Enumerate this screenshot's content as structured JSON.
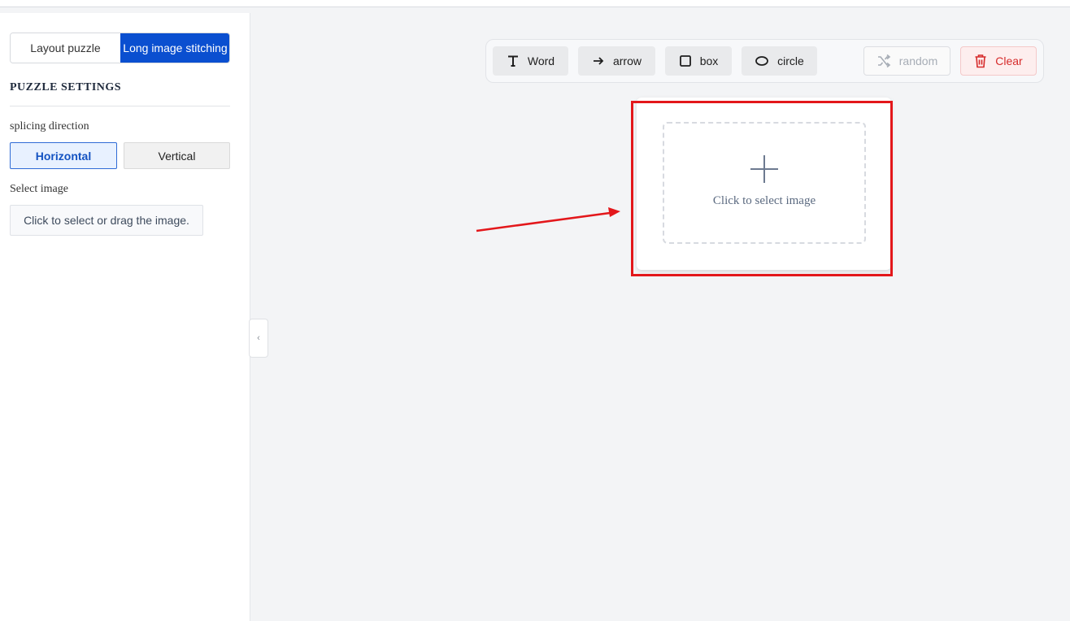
{
  "sidebar": {
    "mode_tabs": [
      {
        "label": "Layout puzzle",
        "active": false
      },
      {
        "label": "Long image stitching",
        "active": true
      }
    ],
    "section_title": "PUZZLE SETTINGS",
    "splicing_direction_label": "splicing direction",
    "direction_options": [
      {
        "label": "Horizontal",
        "selected": true
      },
      {
        "label": "Vertical",
        "selected": false
      }
    ],
    "select_image_label": "Select image",
    "select_image_button": "Click to select or drag the image.",
    "collapse_icon": "‹"
  },
  "toolbar": {
    "word": {
      "label": "Word",
      "icon": "text-icon"
    },
    "arrow": {
      "label": "arrow",
      "icon": "arrow-right-icon"
    },
    "box": {
      "label": "box",
      "icon": "square-icon"
    },
    "circle": {
      "label": "circle",
      "icon": "ellipse-icon"
    },
    "random": {
      "label": "random",
      "icon": "shuffle-icon"
    },
    "clear": {
      "label": "Clear",
      "icon": "trash-icon"
    }
  },
  "canvas": {
    "dropzone_text": "Click to select image"
  },
  "colors": {
    "accent": "#0a4fd0",
    "highlight": "#e3171b",
    "danger": "#d62b2b"
  }
}
